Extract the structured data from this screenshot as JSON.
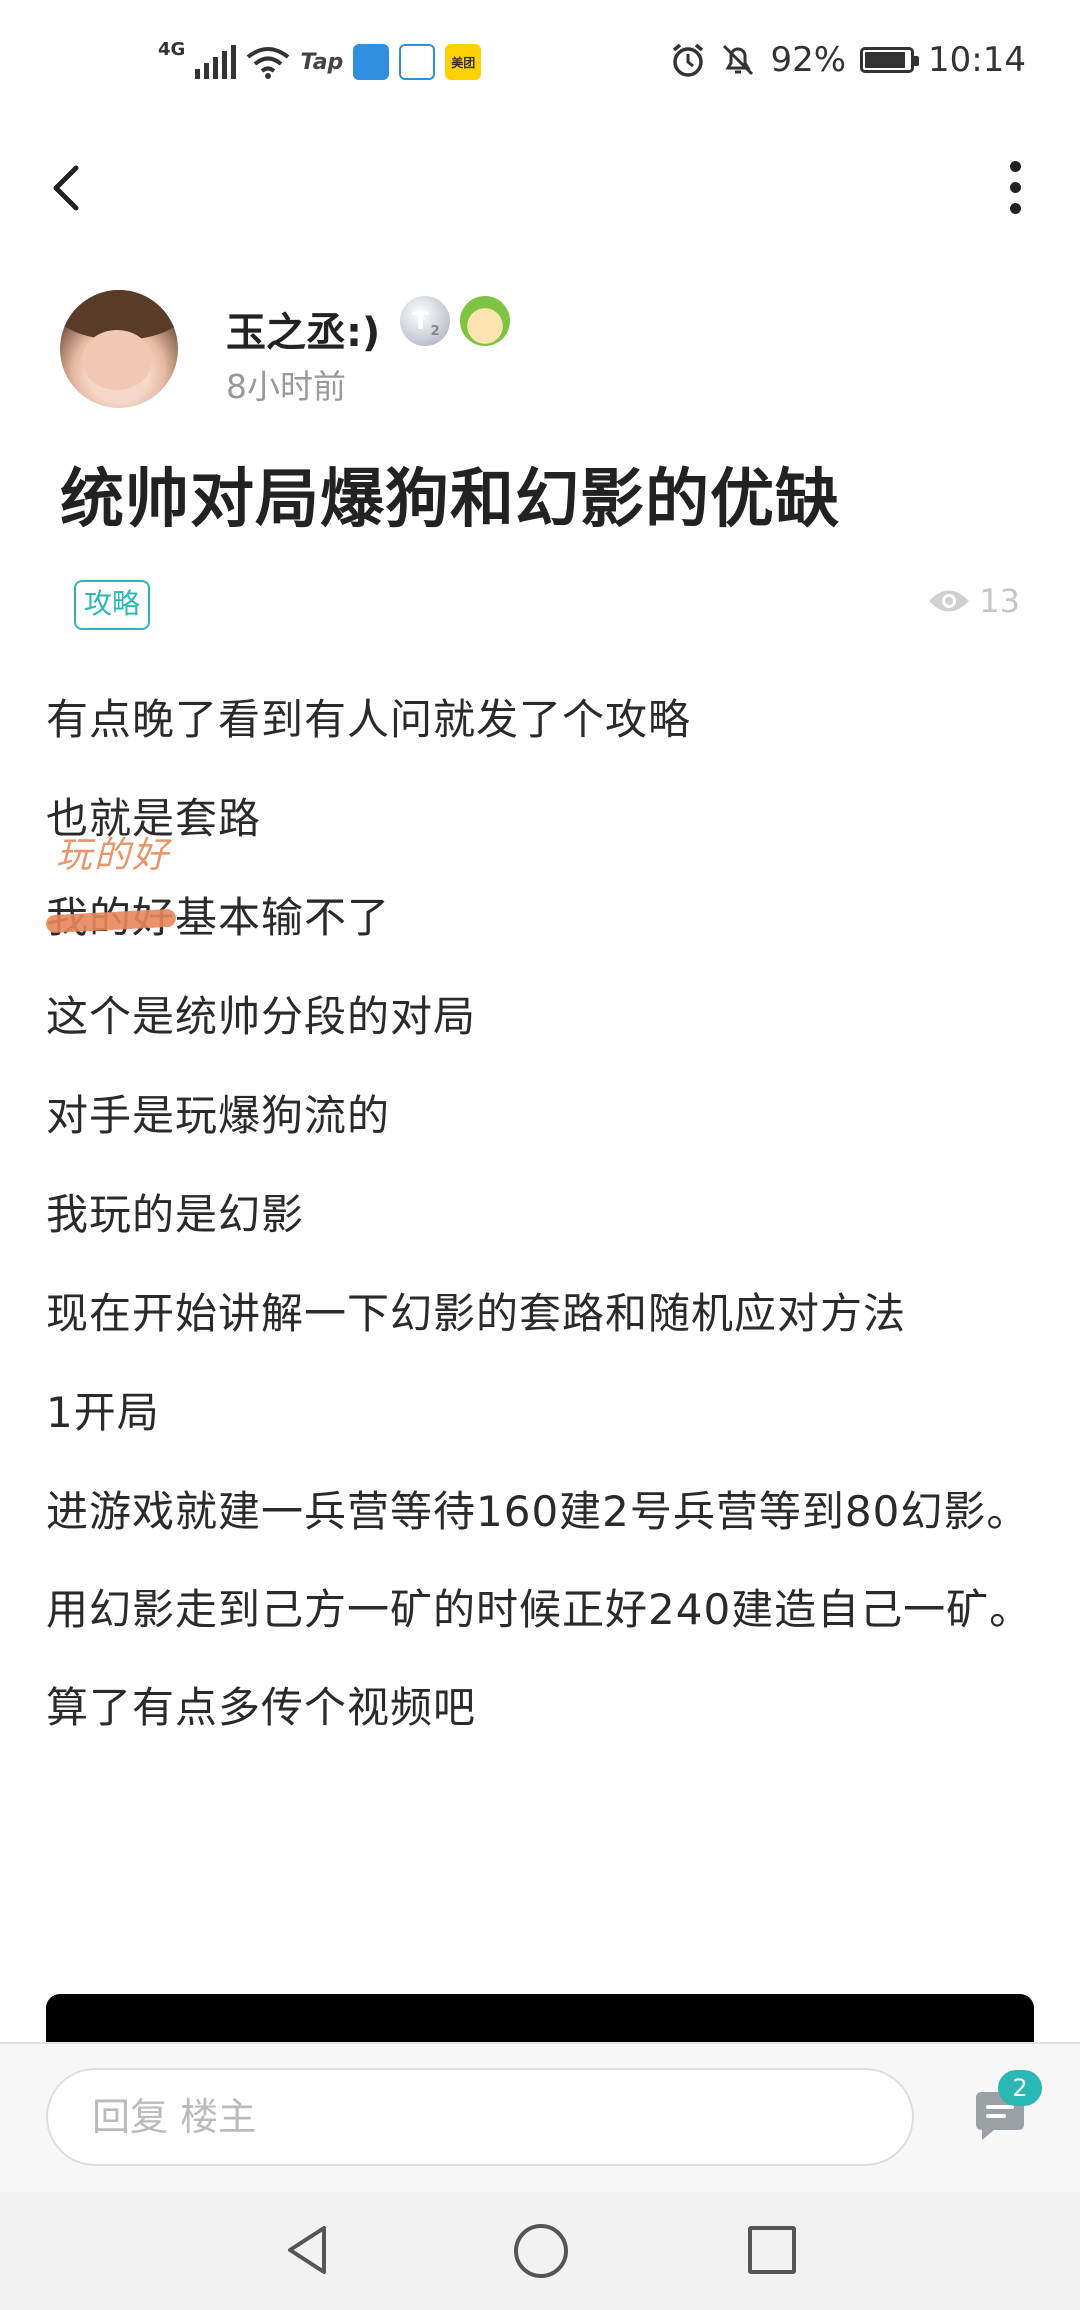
{
  "status_bar": {
    "network": "4G",
    "carrier_app": "Tap",
    "app_icon_1_label": "",
    "app_icon_3_label": "美团",
    "battery": "92%",
    "time": "10:14"
  },
  "nav": {},
  "author": {
    "name": "玉之丞:)",
    "level_badge": "T",
    "level_sub": "2",
    "time_ago": "8小时前"
  },
  "post": {
    "title": "统帅对局爆狗和幻影的优缺",
    "tag": "攻略",
    "views": "13",
    "edited_annotation": "玩的好",
    "paragraphs": [
      "有点晚了看到有人问就发了个攻略",
      "也就是套路",
      "我的好基本输不了",
      "这个是统帅分段的对局",
      "对手是玩爆狗流的",
      "我玩的是幻影",
      "现在开始讲解一下幻影的套路和随机应对方法",
      "1开局",
      "进游戏就建一兵营等待160建2号兵营等到80幻影。",
      "用幻影走到己方一矿的时候正好240建造自己一矿。",
      "算了有点多传个视频吧"
    ]
  },
  "reply": {
    "placeholder": "回复  楼主",
    "comment_count": "2"
  },
  "colors": {
    "accent": "#2bb7b3",
    "annotation": "#e8865a"
  }
}
